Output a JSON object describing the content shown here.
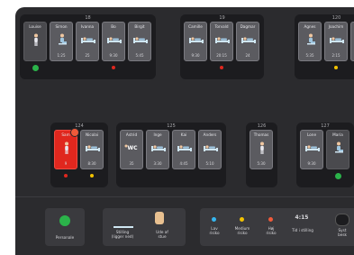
{
  "rooms": [
    {
      "number": "18",
      "patients": [
        {
          "name": "Louise",
          "time": "",
          "icon": "standing",
          "dim": true,
          "status": "green"
        },
        {
          "name": "Simon",
          "time": "1:25",
          "icon": "sitting"
        },
        {
          "name": "Ivanna",
          "time": "25",
          "icon": "bed"
        },
        {
          "name": "Bo",
          "time": "9:30",
          "icon": "bed",
          "status": "red"
        },
        {
          "name": "Birgit",
          "time": "5:45",
          "icon": "bed"
        }
      ]
    },
    {
      "number": "19",
      "patients": [
        {
          "name": "Camille",
          "time": "9:30",
          "icon": "bed"
        },
        {
          "name": "Torvald",
          "time": "20:15",
          "icon": "bed",
          "status": "red"
        },
        {
          "name": "Dagmar",
          "time": "24",
          "icon": "bed"
        }
      ]
    },
    {
      "number": "120",
      "patients": [
        {
          "name": "Agnes",
          "time": "5:35",
          "icon": "sitting"
        },
        {
          "name": "Joachim",
          "time": "2:15",
          "icon": "bed",
          "status": "yellow"
        },
        {
          "name": "",
          "time": "",
          "icon": "bed"
        }
      ]
    },
    {
      "number": "124",
      "patients": [
        {
          "name": "Sam",
          "time": "9",
          "icon": "standing",
          "red": true,
          "status": "red",
          "badge": true
        },
        {
          "name": "Nicolai",
          "time": "8:30",
          "icon": "bed",
          "status": "yellow"
        }
      ]
    },
    {
      "number": "125",
      "patients": [
        {
          "name": "Astrid",
          "time": "35",
          "icon": "wc"
        },
        {
          "name": "Inge",
          "time": "3:30",
          "icon": "bed"
        },
        {
          "name": "Kai",
          "time": "4:45",
          "icon": "bed"
        },
        {
          "name": "Anders",
          "time": "5:10",
          "icon": "bed"
        }
      ]
    },
    {
      "number": "126",
      "patients": [
        {
          "name": "Thomas",
          "time": "5:30",
          "icon": "standing"
        }
      ]
    },
    {
      "number": "127",
      "patients": [
        {
          "name": "Lone",
          "time": "9:30",
          "icon": "bed"
        },
        {
          "name": "Maria",
          "time": "",
          "icon": "sitting",
          "dim": true,
          "status": "green"
        }
      ]
    }
  ],
  "legend": {
    "personale": "Personale",
    "stilling_label": "Stilling",
    "stilling_sub": "(ligger ned)",
    "ude_label": "Ude af",
    "ude_sub": "stue",
    "lav": "Lav",
    "lav_sub": "risiko",
    "medium": "Medium",
    "medium_sub": "risiko",
    "hoj": "Høj",
    "hoj_sub": "risiko",
    "tid_value": "4:15",
    "tid_label": "Tid i stilling",
    "syst_label": "Syst",
    "syst_sub": "besk"
  },
  "colors": {
    "green": "#2bb34a",
    "red": "#e0271e",
    "yellow": "#f2c200",
    "blue": "#35b6f0"
  }
}
